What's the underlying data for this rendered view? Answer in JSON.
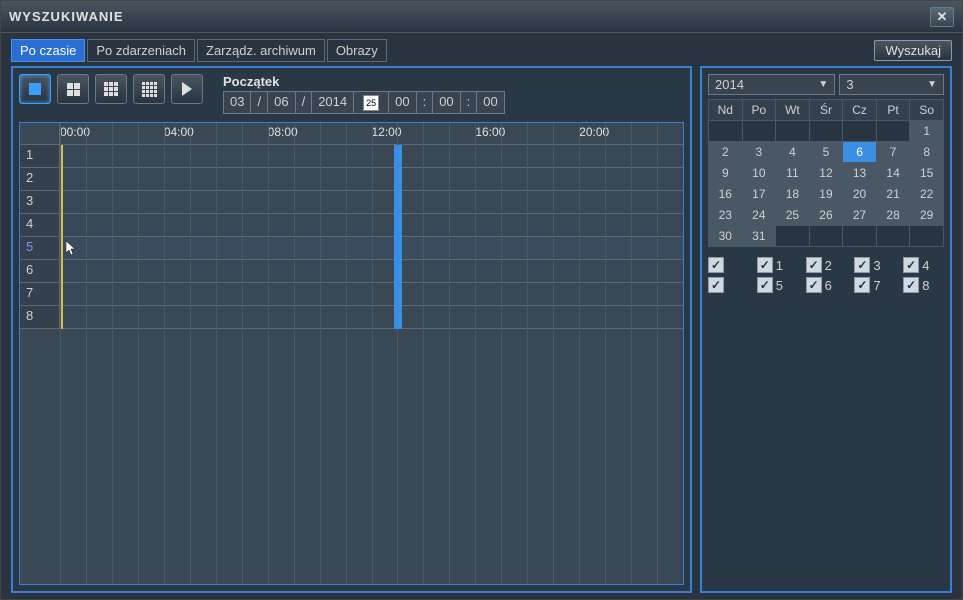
{
  "titlebar": {
    "title": "WYSZUKIWANIE"
  },
  "tabs": {
    "time": "Po czasie",
    "events": "Po zdarzeniach",
    "archive": "Zarządz. archiwum",
    "images": "Obrazy"
  },
  "search_button": "Wyszukaj",
  "start": {
    "label": "Początek",
    "date_dd": "03",
    "date_mm": "06",
    "date_yyyy": "2014",
    "cal_icon_num": "25",
    "time_hh": "00",
    "time_mm": "00",
    "time_ss": "00"
  },
  "time_labels": [
    "00:00",
    "04:00",
    "08:00",
    "12:00",
    "16:00",
    "20:00"
  ],
  "channels": [
    "1",
    "2",
    "3",
    "4",
    "5",
    "6",
    "7",
    "8"
  ],
  "playhead_hour_fraction": 0.538,
  "highlighted_row": 5,
  "calendar": {
    "year": "2014",
    "month": "3",
    "dow": [
      "Nd",
      "Po",
      "Wt",
      "Śr",
      "Cz",
      "Pt",
      "So"
    ],
    "leading_empty": 6,
    "days": 31,
    "selected": 6
  },
  "channel_checks": [
    {
      "n": "1",
      "checked": true
    },
    {
      "n": "2",
      "checked": true
    },
    {
      "n": "3",
      "checked": true
    },
    {
      "n": "4",
      "checked": true
    },
    {
      "n": "5",
      "checked": true
    },
    {
      "n": "6",
      "checked": true
    },
    {
      "n": "7",
      "checked": true
    },
    {
      "n": "8",
      "checked": true
    }
  ],
  "master_check": true
}
